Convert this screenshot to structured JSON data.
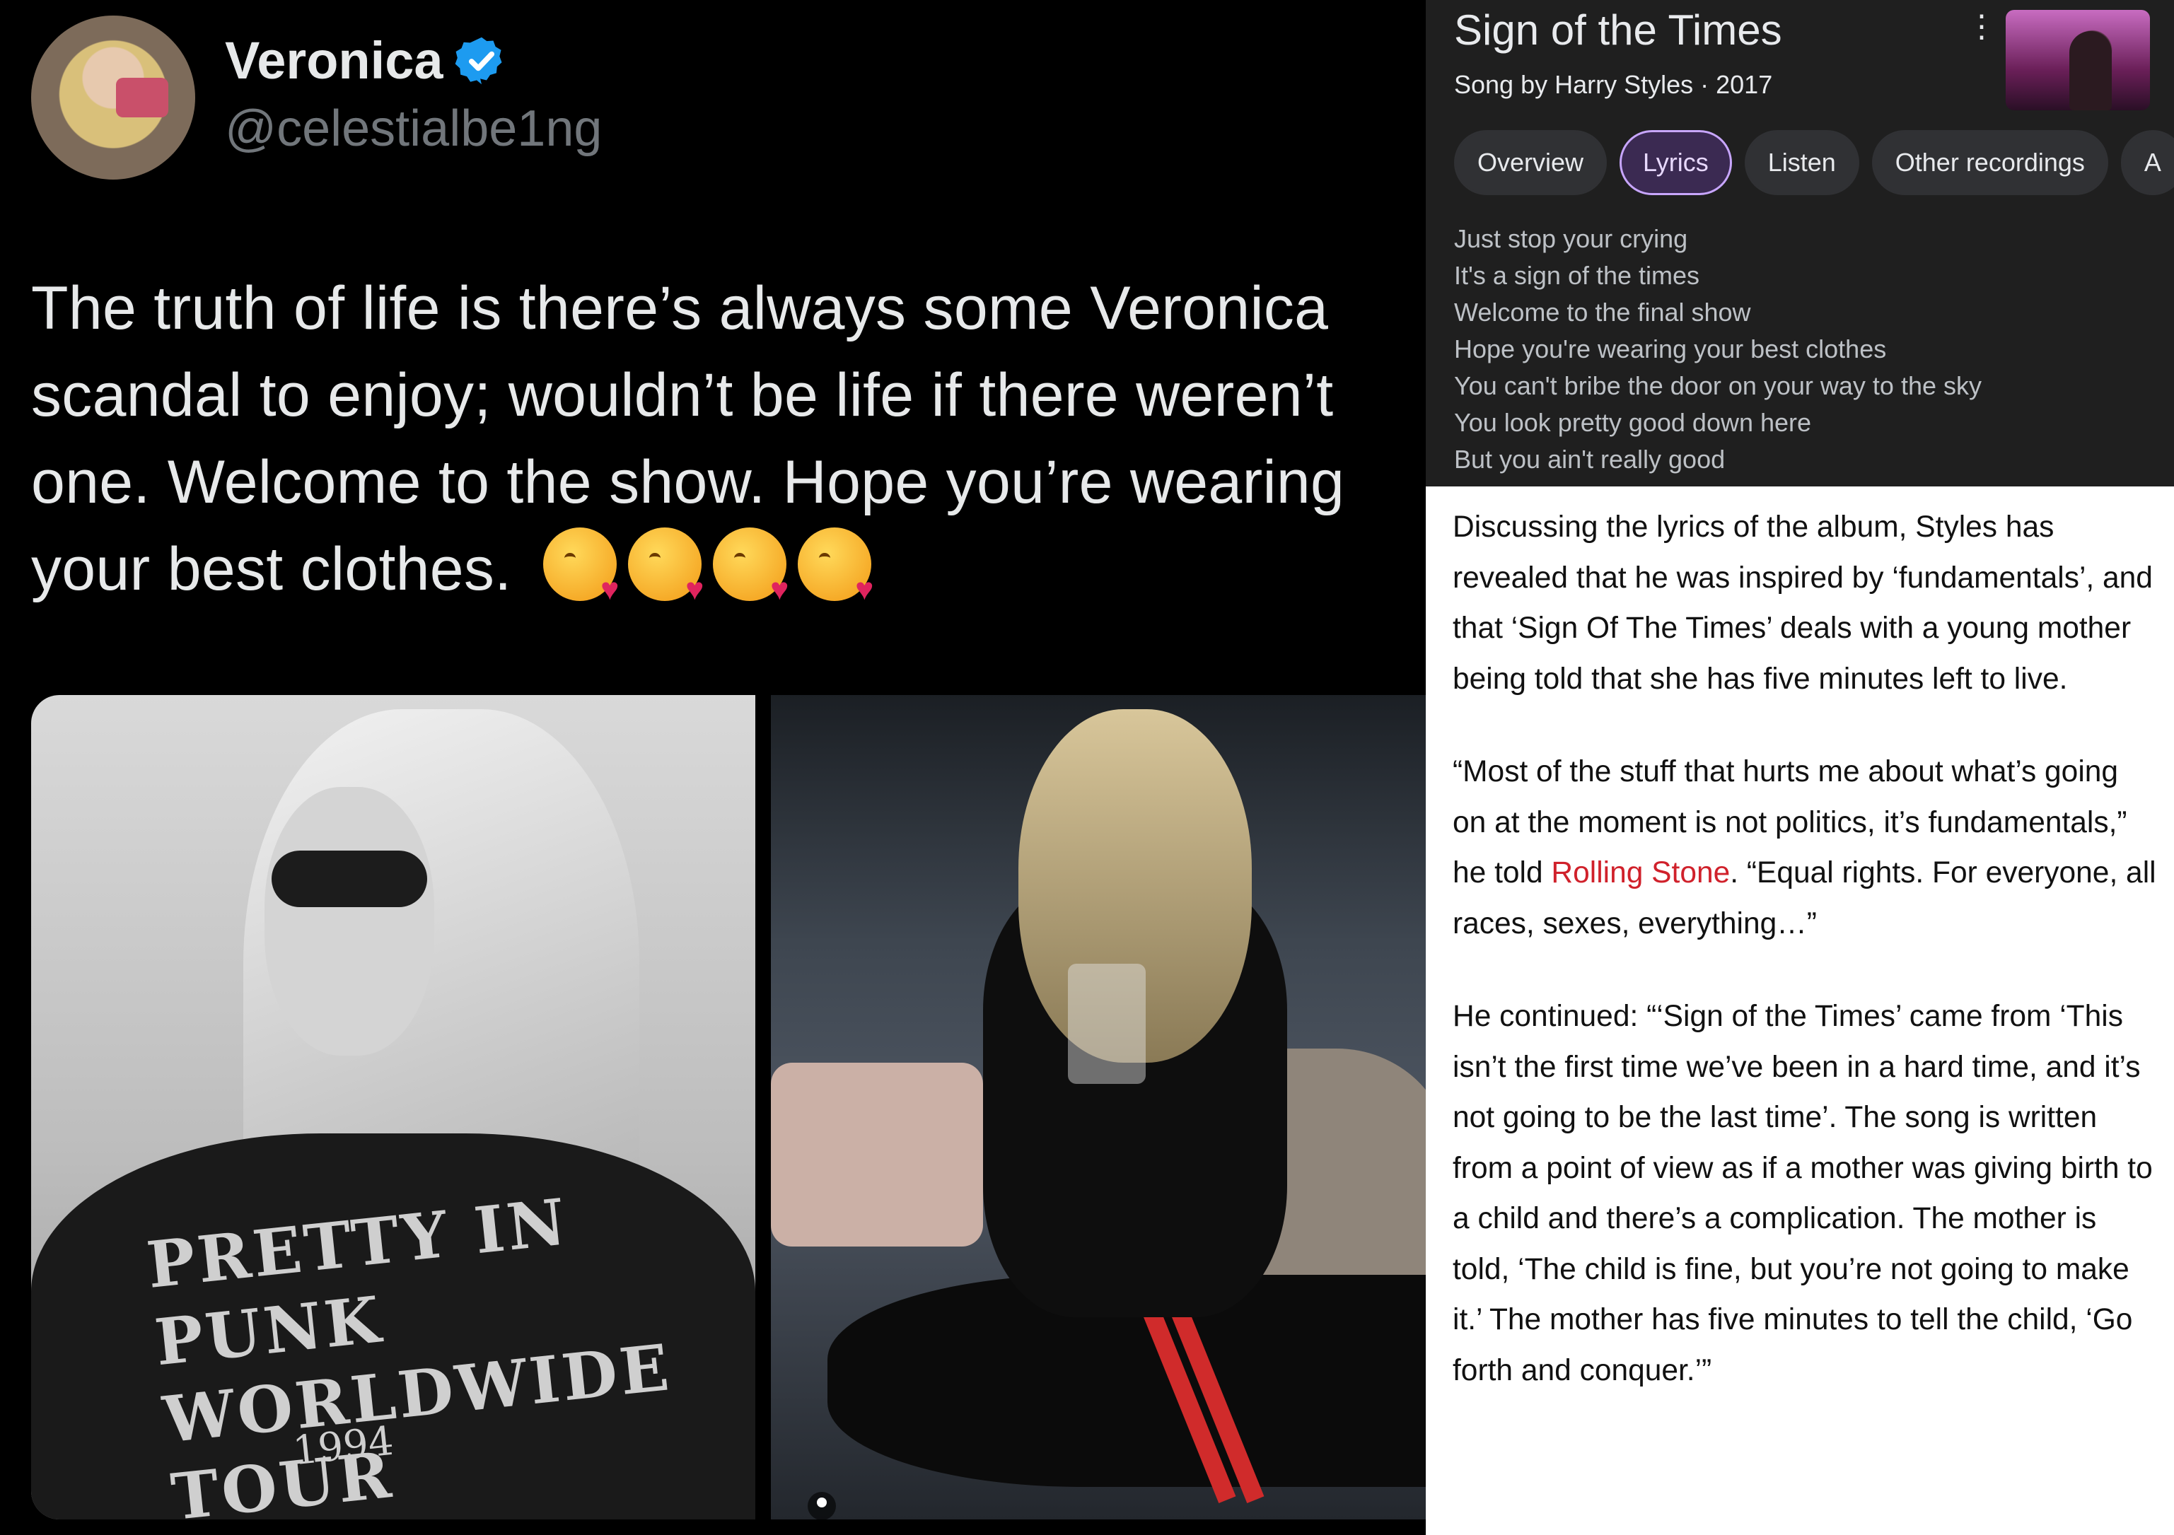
{
  "tweet": {
    "display_name": "Veronica",
    "handle": "@celestialbe1ng",
    "text": "The truth of life is there’s always some Veronica scandal to enjoy; wouldn’t be life if there weren’t one. Welcome to the show. Hope you’re wearing your best clothes.",
    "emoji_count": 4,
    "emoji_icon": "face-blowing-a-kiss-icon",
    "verified_color": "#1d9bf0",
    "photo_1": {
      "tee_print": "PRETTY IN PUNK WORLDWIDE TOUR",
      "tee_year": "1994"
    }
  },
  "search_panel": {
    "title": "Sign of the Times",
    "subtitle": "Song by Harry Styles · 2017",
    "tabs": [
      {
        "label": "Overview",
        "active": false
      },
      {
        "label": "Lyrics",
        "active": true
      },
      {
        "label": "Listen",
        "active": false
      },
      {
        "label": "Other recordings",
        "active": false
      },
      {
        "label": "A",
        "active": false
      }
    ],
    "lyrics": [
      "Just stop your crying",
      "It's a sign of the times",
      "Welcome to the final show",
      "Hope you're wearing your best clothes",
      "You can't bribe the door on your way to the sky",
      "You look pretty good down here",
      "But you ain't really good"
    ],
    "accent_color": "#c8a6ff"
  },
  "article": {
    "p1": "Discussing the lyrics of the album, Styles has revealed that he was inspired by ‘fundamentals’, and that ‘Sign Of The Times’ deals with a young mother being told that she has five minutes left to live.",
    "p2_before": "“Most of the stuff that hurts me about what’s going on at the moment is not politics, it’s fundamentals,” he told ",
    "p2_link": "Rolling Stone",
    "p2_after": ". “Equal rights. For everyone, all races, sexes, everything…”",
    "p3": "He continued: “‘Sign of the Times’ came from ‘This isn’t the first time we’ve been in a hard time, and it’s not going to be the last time’. The song is written from a point of view as if a mother was giving birth to a child and there’s a complication. The mother is told, ‘The child is fine, but you’re not going to make it.’ The mother has five minutes to tell the child, ‘Go forth and conquer.’”",
    "link_color": "#d0212b"
  }
}
